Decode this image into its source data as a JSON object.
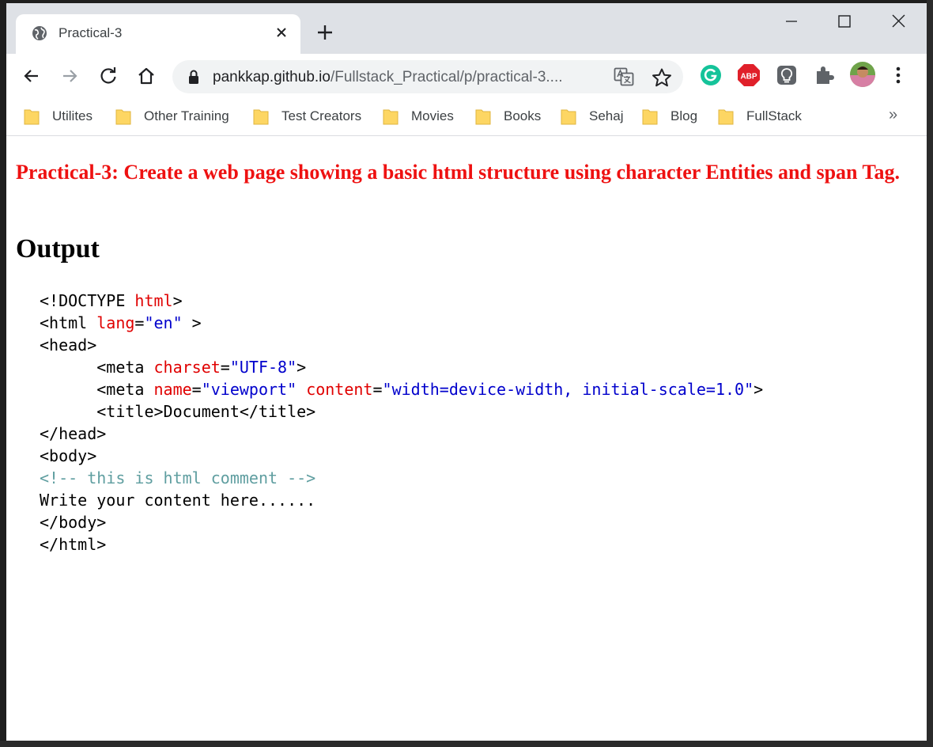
{
  "browser": {
    "tab_title": "Practical-3",
    "url_host": "pankkap.github.io",
    "url_path": "/Fullstack_Practical/p/practical-3....",
    "bookmarks": [
      "Utilites",
      "Other Training",
      "Test Creators",
      "Movies",
      "Books",
      "Sehaj",
      "Blog",
      "FullStack"
    ],
    "bookmarks_overflow": "»",
    "extension_adblock_label": "ABP",
    "icons": {
      "tab_favicon": "globe-icon",
      "tab_close": "close-icon",
      "new_tab": "plus-icon",
      "back": "back-arrow-icon",
      "forward": "forward-arrow-icon",
      "reload": "reload-icon",
      "home": "home-icon",
      "lock": "lock-icon",
      "translate": "translate-icon",
      "bookmark_star": "star-icon",
      "extensions": [
        "grammarly-icon",
        "adblock-plus-icon",
        "lightbulb-extension-icon",
        "puzzle-extensions-icon"
      ],
      "profile": "avatar",
      "menu": "kebab-menu-icon"
    },
    "colors": {
      "titlebar": "#dee1e6",
      "grammarly": "#15c39a",
      "adblock": "#e0202a"
    }
  },
  "page": {
    "heading": "Practical-3: Create a web page showing a basic html structure using character Entities and span Tag.",
    "output_title": "Output",
    "code": {
      "l1_a": "<!DOCTYPE ",
      "l1_b": "html",
      "l1_c": ">",
      "l2_a": "<html ",
      "l2_b": "lang",
      "l2_c": "=",
      "l2_d": "\"en\"",
      "l2_e": " >",
      "l3": "<head>",
      "l4_a": "      <meta ",
      "l4_b": "charset",
      "l4_c": "=",
      "l4_d": "\"UTF-8\"",
      "l4_e": ">",
      "l5_a": "      <meta ",
      "l5_b": "name",
      "l5_c": "=",
      "l5_d": "\"viewport\"",
      "l5_e": " ",
      "l5_f": "content",
      "l5_g": "=",
      "l5_h": "\"width=device-width, initial-scale=1.0\"",
      "l5_i": ">",
      "l6": "      <title>Document</title>",
      "l7": "</head>",
      "l8": "<body>",
      "l9": "<!-- this is html comment -->",
      "l10": "Write your content here......",
      "l11": "</body>",
      "l12": "</html>"
    },
    "colors": {
      "heading": "#ee1111",
      "code_attr": "#e00000",
      "code_value": "#0000cc",
      "code_comment": "#5f9ea0"
    }
  }
}
